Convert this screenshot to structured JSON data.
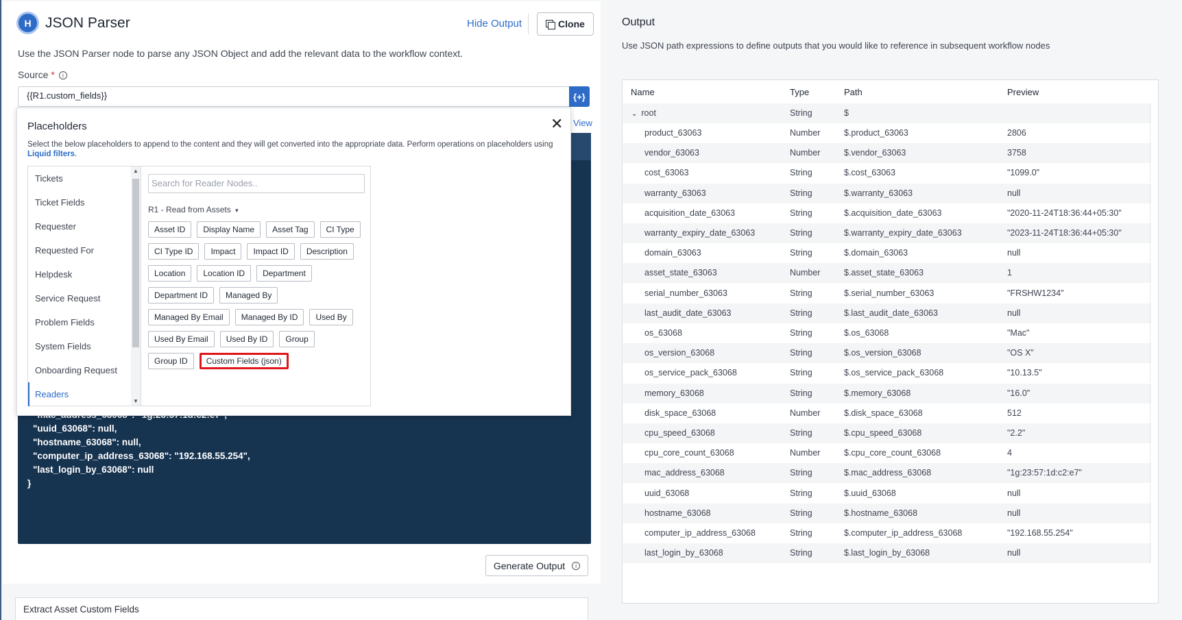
{
  "header": {
    "logo_glyph": "H",
    "title": "JSON Parser",
    "hide_output": "Hide Output",
    "clone": "Clone"
  },
  "left": {
    "description": "Use the JSON Parser node to parse any JSON Object and add the relevant data to the workflow context.",
    "source_label": "Source",
    "required_mark": "*",
    "info_glyph": "i",
    "source_value": "{{R1.custom_fields}}",
    "source_button": "{+}",
    "view_link": "View",
    "code_lines": [
      "\"mac_address_63068\": \"1g:23:57:1d:c2:e7\",",
      "\"uuid_63068\": null,",
      "\"hostname_63068\": null,",
      "\"computer_ip_address_63068\": \"192.168.55.254\",",
      "\"last_login_by_63068\": null",
      "}"
    ],
    "generate_output": "Generate Output",
    "extract_card": "Extract Asset Custom Fields"
  },
  "placeholders": {
    "title": "Placeholders",
    "close": "✕",
    "description": "Select the below placeholders to append to the content and they will get converted into the appropriate data. Perform operations on placeholders using",
    "liquid_link": "Liquid filters",
    "description_end": ".",
    "categories": [
      "Tickets",
      "Ticket Fields",
      "Requester",
      "Requested For",
      "Helpdesk",
      "Service Request",
      "Problem Fields",
      "System Fields",
      "Onboarding Request",
      "Readers"
    ],
    "active_category": "Readers",
    "search_placeholder": "Search for Reader Nodes..",
    "reader_select": "R1 - Read from Assets",
    "chips": [
      [
        "Asset ID",
        "Display Name",
        "Asset Tag",
        "CI Type"
      ],
      [
        "CI Type ID",
        "Impact",
        "Impact ID",
        "Description"
      ],
      [
        "Location",
        "Location ID",
        "Department"
      ],
      [
        "Department ID",
        "Managed By"
      ],
      [
        "Managed By Email",
        "Managed By ID",
        "Used By"
      ],
      [
        "Used By Email",
        "Used By ID",
        "Group"
      ],
      [
        "Group ID",
        "Custom Fields (json)"
      ]
    ],
    "highlighted_chip": "Custom Fields (json)"
  },
  "output": {
    "title": "Output",
    "description": "Use JSON path expressions to define outputs that you would like to reference in subsequent workflow nodes",
    "columns": [
      "Name",
      "Type",
      "Path",
      "Preview"
    ],
    "root": {
      "name": "root",
      "type": "String",
      "path": "$",
      "preview": ""
    },
    "rows": [
      {
        "name": "product_63063",
        "type": "Number",
        "path": "$.product_63063",
        "preview": "2806"
      },
      {
        "name": "vendor_63063",
        "type": "Number",
        "path": "$.vendor_63063",
        "preview": "3758"
      },
      {
        "name": "cost_63063",
        "type": "String",
        "path": "$.cost_63063",
        "preview": "\"1099.0\""
      },
      {
        "name": "warranty_63063",
        "type": "String",
        "path": "$.warranty_63063",
        "preview": "null"
      },
      {
        "name": "acquisition_date_63063",
        "type": "String",
        "path": "$.acquisition_date_63063",
        "preview": "\"2020-11-24T18:36:44+05:30\""
      },
      {
        "name": "warranty_expiry_date_63063",
        "type": "String",
        "path": "$.warranty_expiry_date_63063",
        "preview": "\"2023-11-24T18:36:44+05:30\""
      },
      {
        "name": "domain_63063",
        "type": "String",
        "path": "$.domain_63063",
        "preview": "null"
      },
      {
        "name": "asset_state_63063",
        "type": "Number",
        "path": "$.asset_state_63063",
        "preview": "1"
      },
      {
        "name": "serial_number_63063",
        "type": "String",
        "path": "$.serial_number_63063",
        "preview": "\"FRSHW1234\""
      },
      {
        "name": "last_audit_date_63063",
        "type": "String",
        "path": "$.last_audit_date_63063",
        "preview": "null"
      },
      {
        "name": "os_63068",
        "type": "String",
        "path": "$.os_63068",
        "preview": "\"Mac\""
      },
      {
        "name": "os_version_63068",
        "type": "String",
        "path": "$.os_version_63068",
        "preview": "\"OS X\""
      },
      {
        "name": "os_service_pack_63068",
        "type": "String",
        "path": "$.os_service_pack_63068",
        "preview": "\"10.13.5\""
      },
      {
        "name": "memory_63068",
        "type": "String",
        "path": "$.memory_63068",
        "preview": "\"16.0\""
      },
      {
        "name": "disk_space_63068",
        "type": "Number",
        "path": "$.disk_space_63068",
        "preview": "512"
      },
      {
        "name": "cpu_speed_63068",
        "type": "String",
        "path": "$.cpu_speed_63068",
        "preview": "\"2.2\""
      },
      {
        "name": "cpu_core_count_63068",
        "type": "Number",
        "path": "$.cpu_core_count_63068",
        "preview": "4"
      },
      {
        "name": "mac_address_63068",
        "type": "String",
        "path": "$.mac_address_63068",
        "preview": "\"1g:23:57:1d:c2:e7\""
      },
      {
        "name": "uuid_63068",
        "type": "String",
        "path": "$.uuid_63068",
        "preview": "null"
      },
      {
        "name": "hostname_63068",
        "type": "String",
        "path": "$.hostname_63068",
        "preview": "null"
      },
      {
        "name": "computer_ip_address_63068",
        "type": "String",
        "path": "$.computer_ip_address_63068",
        "preview": "\"192.168.55.254\""
      },
      {
        "name": "last_login_by_63068",
        "type": "String",
        "path": "$.last_login_by_63068",
        "preview": "null"
      }
    ]
  },
  "colors": {
    "accent": "#2e6bc6",
    "code_bg": "#163350",
    "highlight": "#e0141a"
  }
}
